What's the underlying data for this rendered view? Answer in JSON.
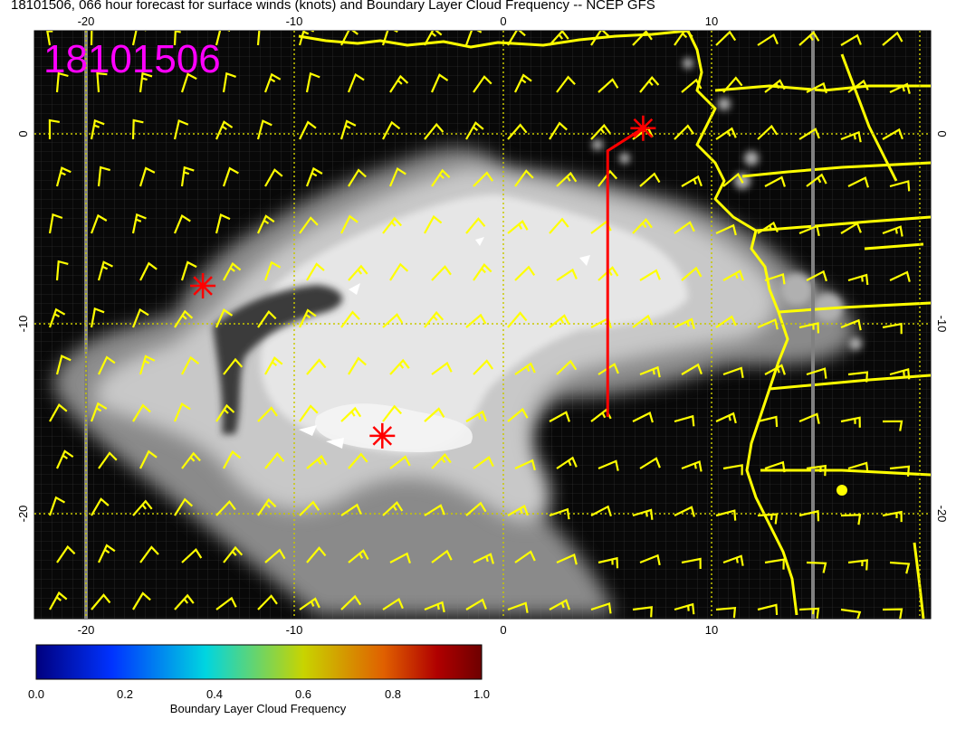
{
  "title": "18101506, 066 hour forecast for surface winds (knots) and Boundary Layer Cloud Frequency -- NCEP GFS",
  "stamp": "18101506",
  "x_ticks": [
    "-20",
    "-10",
    "0",
    "10"
  ],
  "y_ticks": [
    "0",
    "-10",
    "-20"
  ],
  "colorbar": {
    "title": "Boundary Layer Cloud Frequency",
    "ticks": [
      "0.0",
      "0.2",
      "0.4",
      "0.6",
      "0.8",
      "1.0"
    ],
    "colors": [
      "#00007f",
      "#0033ff",
      "#00d5e0",
      "#c8d400",
      "#e06000",
      "#b00000",
      "#6e0000"
    ]
  },
  "colors": {
    "ocean": "#080808",
    "coast": "#ffff00",
    "wind_barb": "#ffff00",
    "grid": "#c8c800",
    "stamp": "#ff00ff",
    "markers": "#ff0000"
  },
  "markers": [
    {
      "lon": 6.7,
      "lat": 0.3
    },
    {
      "lon": -14.4,
      "lat": -8.0
    },
    {
      "lon": -5.8,
      "lat": -15.9
    }
  ],
  "transect": {
    "lon_start": 5.0,
    "lat_start": -14.9,
    "lon_end": 6.7,
    "lat_end": 0.3
  }
}
